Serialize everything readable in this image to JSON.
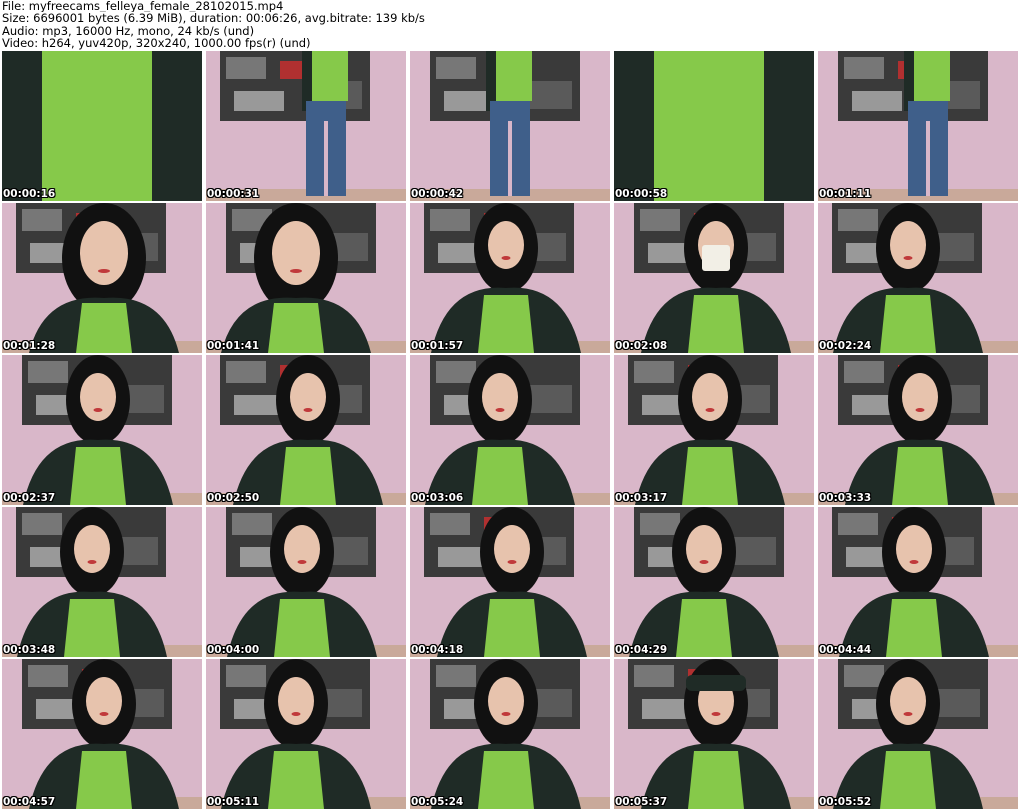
{
  "header": {
    "file": "File: myfreecams_felleya_female_28102015.mp4",
    "size": "Size: 6696001 bytes (6.39 MiB), duration: 00:06:26, avg.bitrate: 139 kb/s",
    "audio": "Audio: mp3, 16000 Hz, mono, 24 kb/s (und)",
    "video": "Video: h264, yuv420p, 320x240, 1000.00 fps(r) (und)"
  },
  "colors": {
    "wall": "#d9b7c9",
    "poster": "#3a3a3a",
    "shirt": "#86c94a",
    "cardigan": "#1f2b26",
    "hair": "#111111",
    "skin": "#e7c3ad",
    "jeans": "#3f5f8a"
  },
  "thumbnails": [
    {
      "time": "00:00:16",
      "scene": "closeup"
    },
    {
      "time": "00:00:31",
      "scene": "standing"
    },
    {
      "time": "00:00:42",
      "scene": "standing-center"
    },
    {
      "time": "00:00:58",
      "scene": "closeup"
    },
    {
      "time": "00:01:11",
      "scene": "standing-right"
    },
    {
      "time": "00:01:28",
      "scene": "face-close"
    },
    {
      "time": "00:01:41",
      "scene": "face-close"
    },
    {
      "time": "00:01:57",
      "scene": "seated"
    },
    {
      "time": "00:02:08",
      "scene": "seated-cup"
    },
    {
      "time": "00:02:24",
      "scene": "seated"
    },
    {
      "time": "00:02:37",
      "scene": "seated"
    },
    {
      "time": "00:02:50",
      "scene": "seated"
    },
    {
      "time": "00:03:06",
      "scene": "seated"
    },
    {
      "time": "00:03:17",
      "scene": "seated"
    },
    {
      "time": "00:03:33",
      "scene": "seated"
    },
    {
      "time": "00:03:48",
      "scene": "seated"
    },
    {
      "time": "00:04:00",
      "scene": "seated"
    },
    {
      "time": "00:04:18",
      "scene": "seated"
    },
    {
      "time": "00:04:29",
      "scene": "seated"
    },
    {
      "time": "00:04:44",
      "scene": "seated"
    },
    {
      "time": "00:04:57",
      "scene": "seated"
    },
    {
      "time": "00:05:11",
      "scene": "seated"
    },
    {
      "time": "00:05:24",
      "scene": "seated"
    },
    {
      "time": "00:05:37",
      "scene": "seated-hands"
    },
    {
      "time": "00:05:52",
      "scene": "seated"
    }
  ]
}
